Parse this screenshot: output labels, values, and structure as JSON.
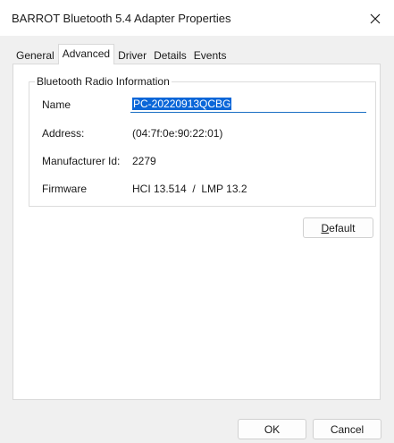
{
  "window": {
    "title": "BARROT Bluetooth 5.4 Adapter Properties",
    "close_glyph": "✕"
  },
  "tabs": [
    {
      "label": "General",
      "active": false
    },
    {
      "label": "Advanced",
      "active": true
    },
    {
      "label": "Driver",
      "active": false
    },
    {
      "label": "Details",
      "active": false
    },
    {
      "label": "Events",
      "active": false
    }
  ],
  "radio_info": {
    "legend": "Bluetooth Radio Information",
    "name_label": "Name",
    "name_value": "PC-20220913QCBG",
    "address_label": "Address:",
    "address_value": "(04:7f:0e:90:22:01)",
    "manufacturer_label": "Manufacturer Id:",
    "manufacturer_value": "2279",
    "firmware_label": "Firmware",
    "firmware_value": "HCI 13.514  /  LMP 13.2"
  },
  "buttons": {
    "default_mnemonic": "D",
    "default_rest": "efault",
    "ok": "OK",
    "cancel": "Cancel"
  },
  "colors": {
    "selection": "#0a66d8",
    "focus_underline": "#1a6fc4",
    "panel_background": "#f0f0f0"
  },
  "icons": {
    "close": "close-icon"
  }
}
